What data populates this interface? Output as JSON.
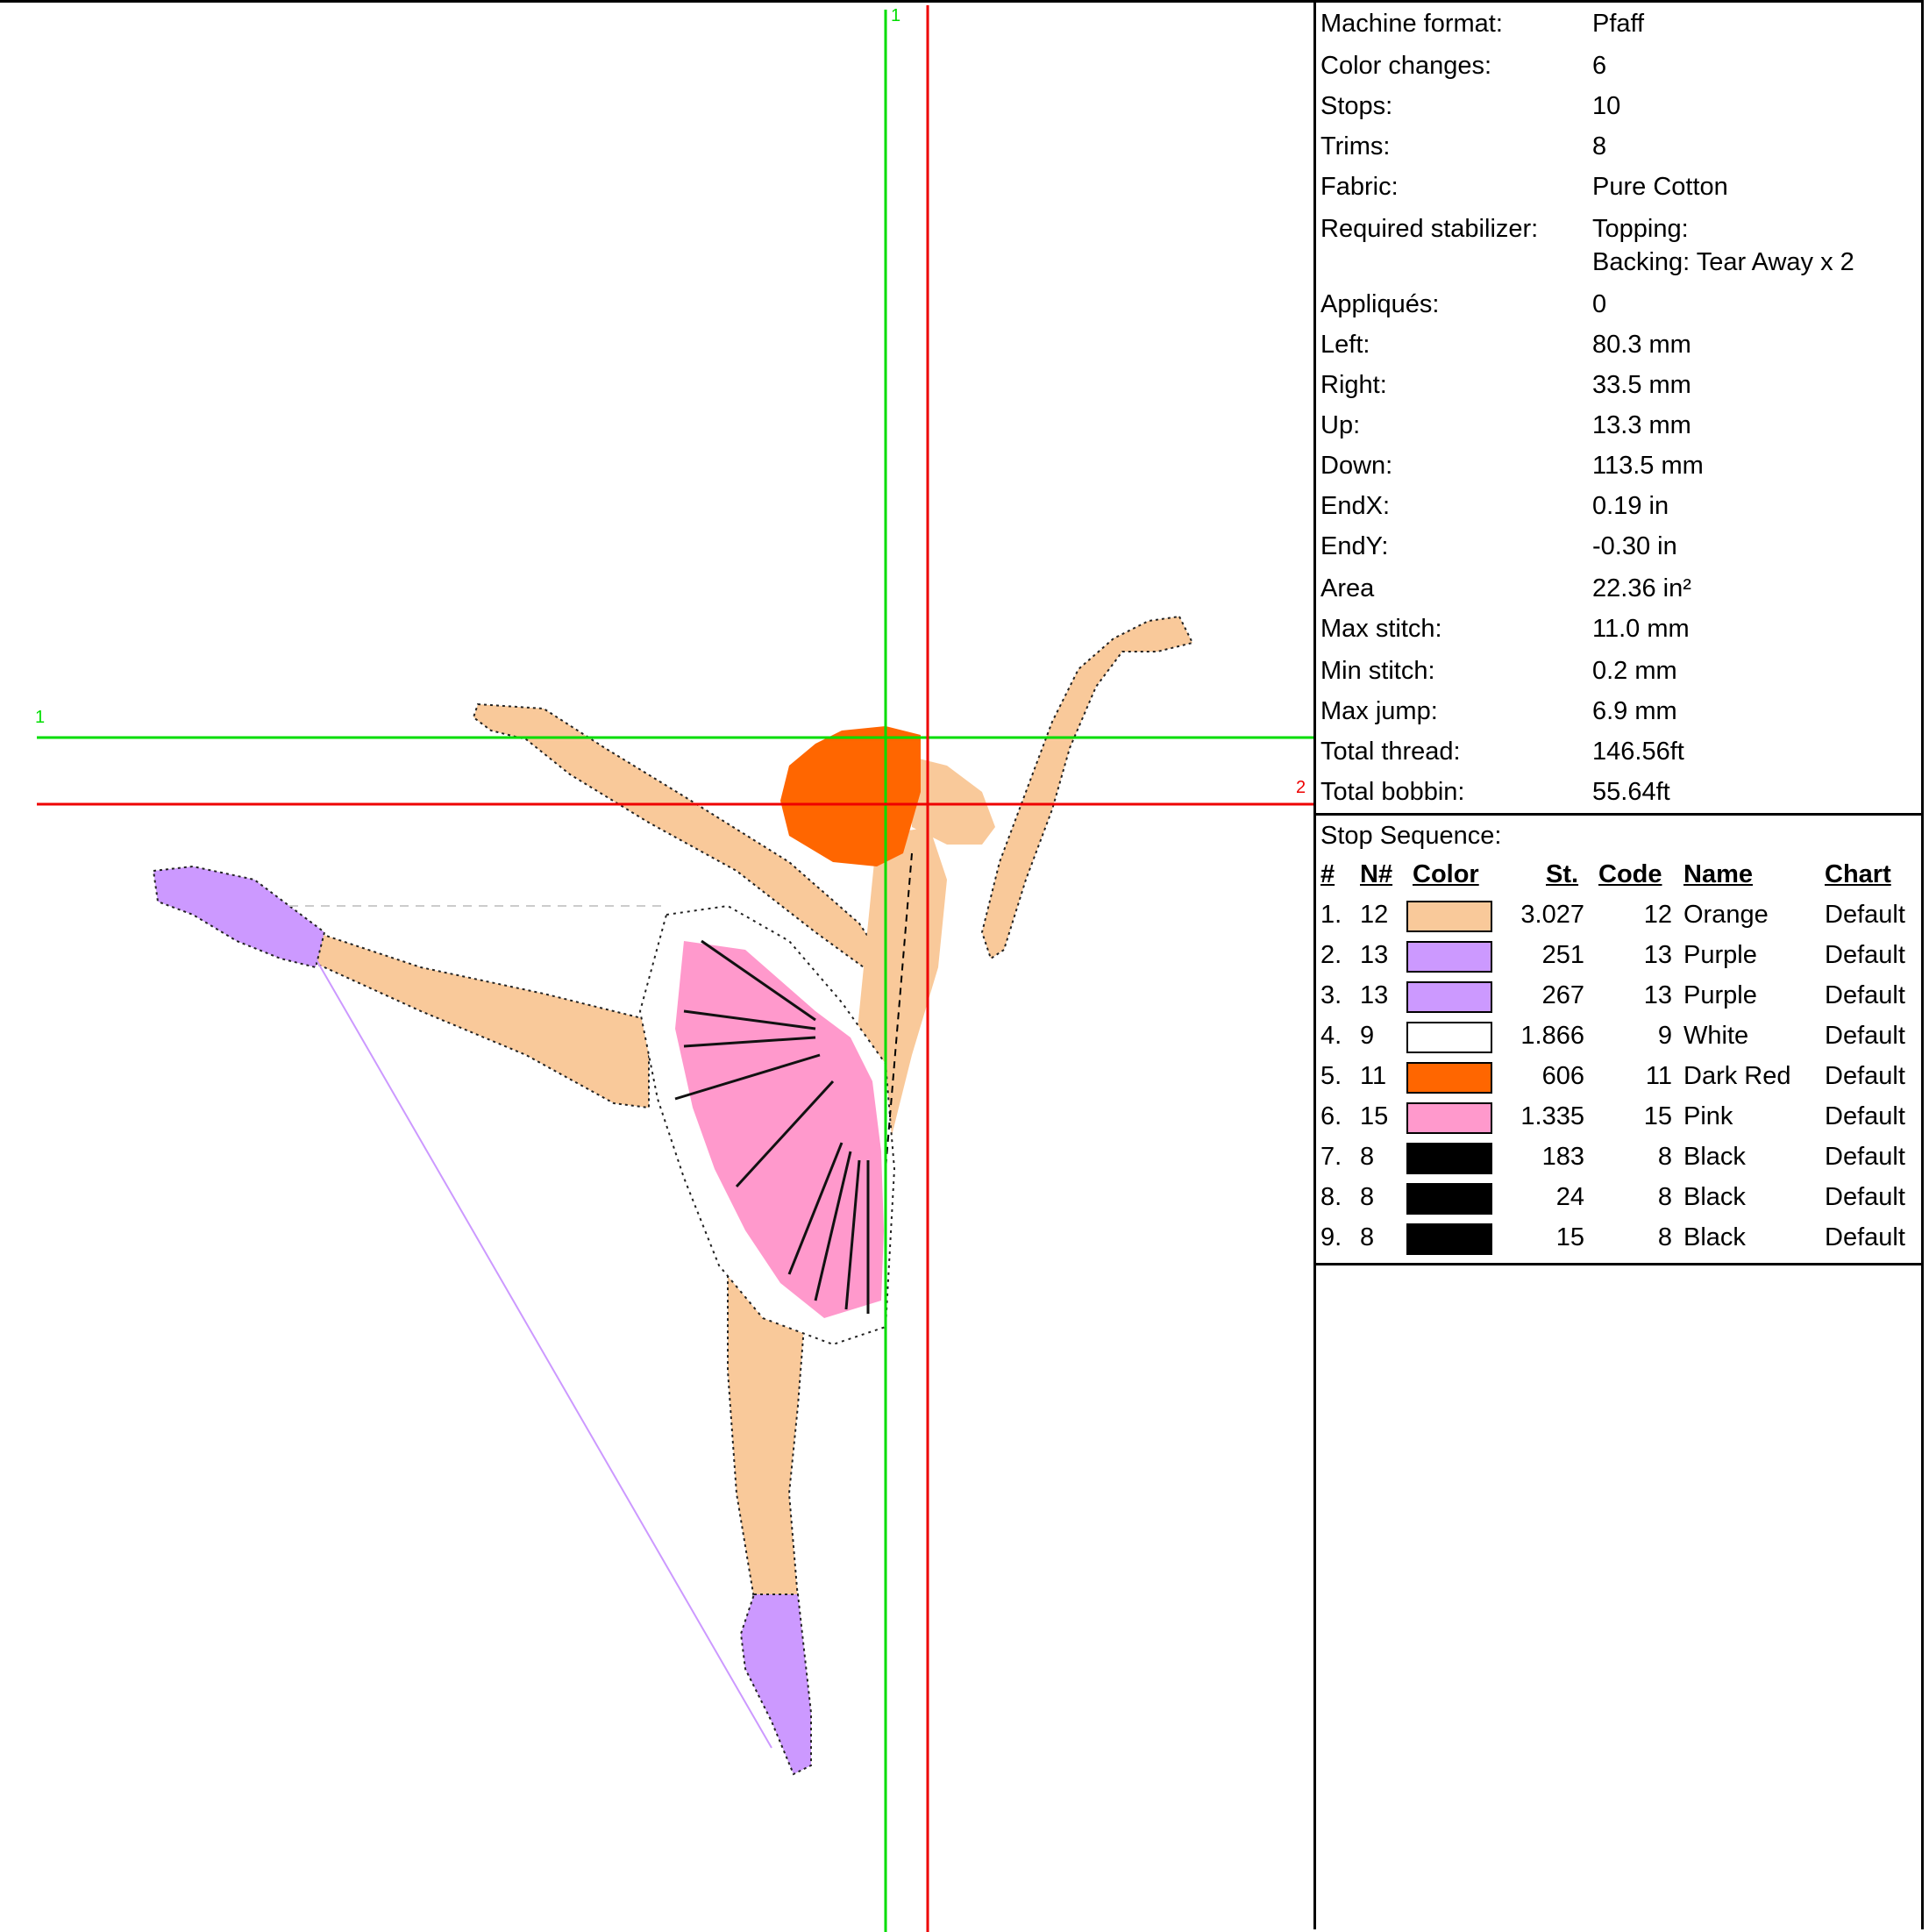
{
  "canvas": {
    "guide_vertical_green_label": "1",
    "guide_horizontal_green_label": "1",
    "guide_horizontal_red_label": "2"
  },
  "info": [
    {
      "label": "Machine format:",
      "value": "Pfaff"
    },
    {
      "label": "Color changes:",
      "value": "6"
    },
    {
      "label": "Stops:",
      "value": "10"
    },
    {
      "label": "Trims:",
      "value": "8"
    },
    {
      "label": "Fabric:",
      "value": "Pure Cotton"
    },
    {
      "label": "Required stabilizer:",
      "value": "Topping:",
      "value2": "Backing: Tear Away x 2"
    },
    {
      "label": "Appliqués:",
      "value": "0"
    },
    {
      "label": "Left:",
      "value": "80.3 mm"
    },
    {
      "label": "Right:",
      "value": "33.5 mm"
    },
    {
      "label": "Up:",
      "value": "13.3 mm"
    },
    {
      "label": "Down:",
      "value": "113.5 mm"
    },
    {
      "label": "EndX:",
      "value": "0.19 in"
    },
    {
      "label": "EndY:",
      "value": "-0.30 in"
    },
    {
      "label": "Area",
      "value": " 22.36 in²"
    },
    {
      "label": "Max stitch:",
      "value": "11.0 mm"
    },
    {
      "label": "Min stitch:",
      "value": "0.2 mm"
    },
    {
      "label": "Max jump:",
      "value": "6.9 mm"
    },
    {
      "label": "Total thread:",
      "value": "146.56ft"
    },
    {
      "label": "Total bobbin:",
      "value": "55.64ft"
    }
  ],
  "stop_sequence": {
    "title": "Stop Sequence:",
    "columns": {
      "num": "#",
      "n": "N#",
      "color": "Color",
      "st": "St.",
      "code": "Code",
      "name": "Name",
      "chart": "Chart"
    },
    "rows": [
      {
        "num": "1.",
        "n": "12",
        "color": "#f9c99a",
        "st": "3.027",
        "code": "12",
        "name": "Orange",
        "chart": "Default"
      },
      {
        "num": "2.",
        "n": "13",
        "color": "#cc99ff",
        "st": "251",
        "code": "13",
        "name": "Purple",
        "chart": "Default"
      },
      {
        "num": "3.",
        "n": "13",
        "color": "#cc99ff",
        "st": "267",
        "code": "13",
        "name": "Purple",
        "chart": "Default"
      },
      {
        "num": "4.",
        "n": "9",
        "color": "#ffffff",
        "st": "1.866",
        "code": "9",
        "name": "White",
        "chart": "Default"
      },
      {
        "num": "5.",
        "n": "11",
        "color": "#ff6600",
        "st": "606",
        "code": "11",
        "name": "Dark Red",
        "chart": "Default"
      },
      {
        "num": "6.",
        "n": "15",
        "color": "#ff99cc",
        "st": "1.335",
        "code": "15",
        "name": "Pink",
        "chart": "Default"
      },
      {
        "num": "7.",
        "n": "8",
        "color": "#000000",
        "st": "183",
        "code": "8",
        "name": "Black",
        "chart": "Default"
      },
      {
        "num": "8.",
        "n": "8",
        "color": "#000000",
        "st": "24",
        "code": "8",
        "name": "Black",
        "chart": "Default"
      },
      {
        "num": "9.",
        "n": "8",
        "color": "#000000",
        "st": "15",
        "code": "8",
        "name": "Black",
        "chart": "Default"
      }
    ]
  },
  "colors": {
    "skin": "#f9c99a",
    "shoe": "#cc99ff",
    "hair": "#ff6600",
    "tutu": "#ff99cc",
    "guide_green": "#00dd00",
    "guide_red": "#ee0000"
  }
}
